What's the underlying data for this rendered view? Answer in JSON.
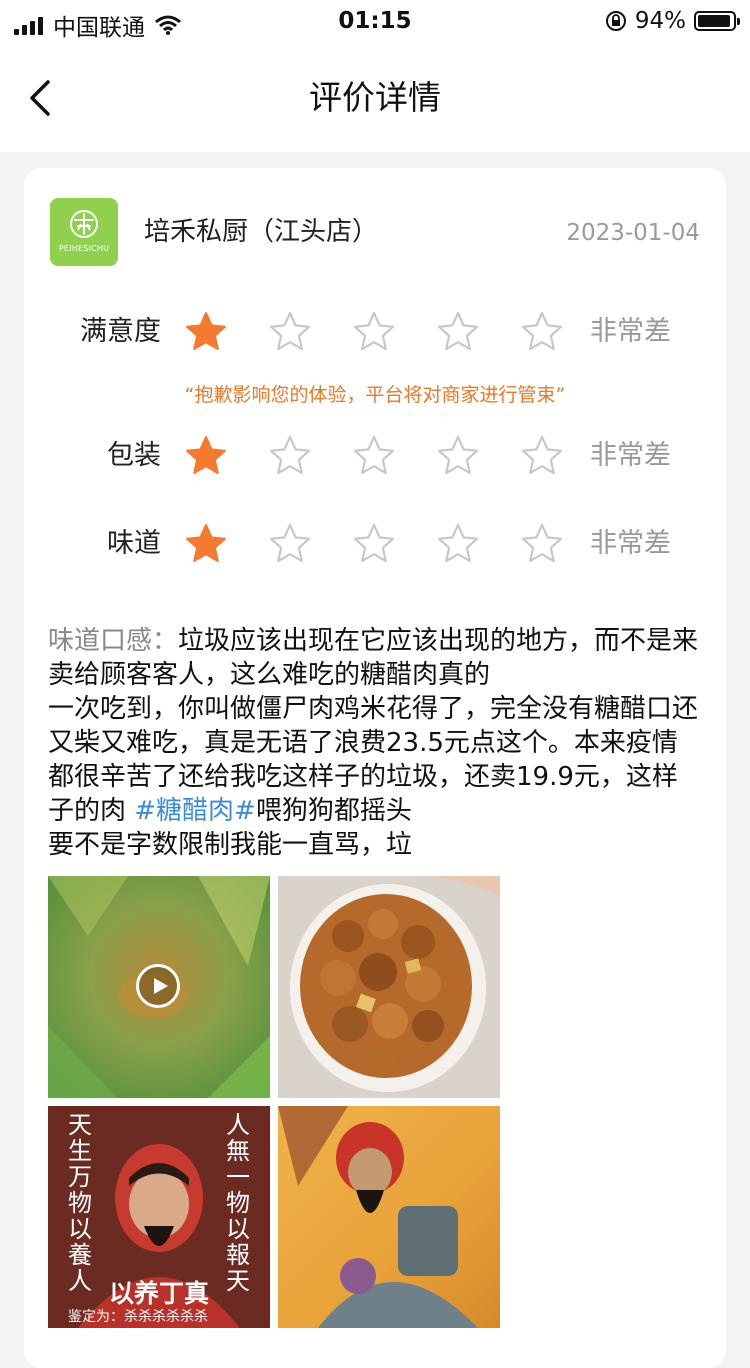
{
  "status_bar": {
    "carrier": "中国联通",
    "time": "01:15",
    "battery": "94%"
  },
  "nav": {
    "title": "评价详情"
  },
  "shop": {
    "name": "培禾私厨（江头店）",
    "logo_text": "PEIHESICHU",
    "date": "2023-01-04"
  },
  "ratings": [
    {
      "label": "满意度",
      "stars": 1,
      "max": 5,
      "status": "非常差"
    },
    {
      "label": "包装",
      "stars": 1,
      "max": 5,
      "status": "非常差"
    },
    {
      "label": "味道",
      "stars": 1,
      "max": 5,
      "status": "非常差"
    }
  ],
  "apology": "“抱歉影响您的体验，平台将对商家进行管束”",
  "review": {
    "label": "味道口感：",
    "text_1": "垃圾应该出现在它应该出现的地方，而不是来卖给顾客客人，这么难吃的糖醋肉真的",
    "text_2": "一次吃到，你叫做僵尸肉鸡米花得了，完全没有糖醋口还又柴又难吃，真是无语了浪费23.5元点这个。本来疫情都很辛苦了还给我吃这样子的垃圾，还卖19.9元，这样子的肉 ",
    "hashtag": "#糖醋肉#",
    "text_3": "喂狗狗都摇头",
    "text_4": "要不是字数限制我能一直骂，垃"
  },
  "photos": {
    "p3": {
      "left": "天生万物以養人",
      "right": "人無一物以報天",
      "caption": "以养丁真",
      "bottom": "鉴定为：杀杀杀杀杀杀"
    }
  },
  "colors": {
    "star_on": "#f47a2f",
    "star_off": "#c8c8c8",
    "hashtag": "#3d8bd6",
    "apology": "#e8782a",
    "logo_bg": "#8fd14f"
  }
}
